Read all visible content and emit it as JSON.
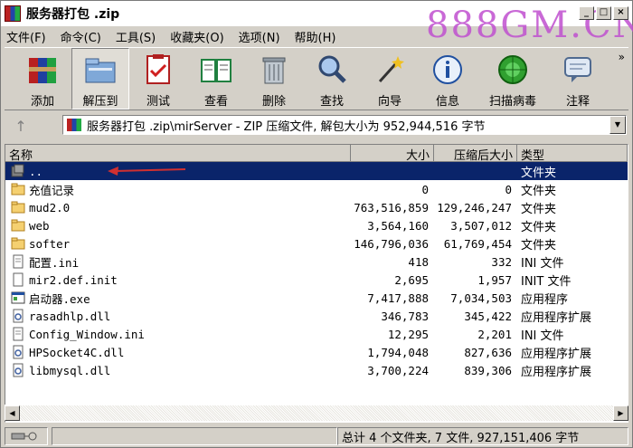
{
  "window": {
    "title": "服务器打包 .zip",
    "watermark": "888GM.CN",
    "minimize_label": "_",
    "maximize_label": "□",
    "close_label": "×"
  },
  "menu": [
    "文件(F)",
    "命令(C)",
    "工具(S)",
    "收藏夹(O)",
    "选项(N)",
    "帮助(H)"
  ],
  "toolbar": {
    "tools": [
      {
        "label": "添加",
        "icon": "add-archive-icon"
      },
      {
        "label": "解压到",
        "icon": "extract-to-icon"
      },
      {
        "label": "测试",
        "icon": "test-icon"
      },
      {
        "label": "查看",
        "icon": "view-book-icon"
      },
      {
        "label": "删除",
        "icon": "trash-icon"
      },
      {
        "label": "查找",
        "icon": "magnifier-icon"
      },
      {
        "label": "向导",
        "icon": "wizard-wand-icon"
      },
      {
        "label": "信息",
        "icon": "info-icon"
      },
      {
        "label": "扫描病毒",
        "icon": "virus-scan-icon"
      },
      {
        "label": "注释",
        "icon": "comment-icon"
      }
    ],
    "more": "»"
  },
  "address": {
    "up_label": "↑",
    "path": "服务器打包 .zip\\mirServer - ZIP 压缩文件, 解包大小为 952,944,516 字节"
  },
  "columns": {
    "name": "名称",
    "size": "大小",
    "packed": "压缩后大小",
    "type": "类型"
  },
  "rows": [
    {
      "name": "..",
      "size": "",
      "packed": "",
      "type": "文件夹",
      "icon": "up-folder-icon",
      "selected": true
    },
    {
      "name": "充值记录",
      "size": "0",
      "packed": "0",
      "type": "文件夹",
      "icon": "folder-icon"
    },
    {
      "name": "mud2.0",
      "size": "763,516,859",
      "packed": "129,246,247",
      "type": "文件夹",
      "icon": "folder-icon"
    },
    {
      "name": "web",
      "size": "3,564,160",
      "packed": "3,507,012",
      "type": "文件夹",
      "icon": "folder-icon"
    },
    {
      "name": "softer",
      "size": "146,796,036",
      "packed": "61,769,454",
      "type": "文件夹",
      "icon": "folder-icon"
    },
    {
      "name": "配置.ini",
      "size": "418",
      "packed": "332",
      "type": "INI 文件",
      "icon": "ini-file-icon"
    },
    {
      "name": "mir2.def.init",
      "size": "2,695",
      "packed": "1,957",
      "type": "INIT 文件",
      "icon": "file-icon"
    },
    {
      "name": "启动器.exe",
      "size": "7,417,888",
      "packed": "7,034,503",
      "type": "应用程序",
      "icon": "exe-icon"
    },
    {
      "name": "rasadhlp.dll",
      "size": "346,783",
      "packed": "345,422",
      "type": "应用程序扩展",
      "icon": "dll-icon"
    },
    {
      "name": "Config_Window.ini",
      "size": "12,295",
      "packed": "2,201",
      "type": "INI 文件",
      "icon": "ini-file-icon"
    },
    {
      "name": "HPSocket4C.dll",
      "size": "1,794,048",
      "packed": "827,636",
      "type": "应用程序扩展",
      "icon": "dll-icon"
    },
    {
      "name": "libmysql.dll",
      "size": "3,700,224",
      "packed": "839,306",
      "type": "应用程序扩展",
      "icon": "dll-icon"
    }
  ],
  "status": {
    "summary": "总计 4 个文件夹, 7 文件, 927,151,406 字节"
  },
  "colors": {
    "selection": "#0a246a",
    "annotation_arrow": "#d03030",
    "watermark": "#c050d0"
  }
}
